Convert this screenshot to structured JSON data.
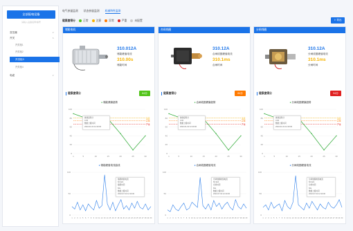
{
  "sidebar": {
    "title": "全部配电设备",
    "subtitle": "请输入设备名称/编号",
    "items": [
      {
        "label": "变压器",
        "type": "group"
      },
      {
        "label": "开关",
        "type": "group"
      },
      {
        "label": "开关柜1",
        "type": "sub"
      },
      {
        "label": "开关柜2",
        "type": "sub"
      },
      {
        "label": "开关柜3",
        "type": "sub",
        "active": true
      },
      {
        "label": "开关柜4",
        "type": "sub"
      },
      {
        "label": "电缆",
        "type": "group"
      }
    ]
  },
  "tabs": [
    {
      "label": "电气参量监测"
    },
    {
      "label": "状态参量监测"
    },
    {
      "label": "机械特性监测",
      "active": true
    }
  ],
  "legend": {
    "title": "健康度得分",
    "items": [
      {
        "label": "正常",
        "color": "#52c41a"
      },
      {
        "label": "注意",
        "color": "#f6b300"
      },
      {
        "label": "异常",
        "color": "#ff7a00"
      },
      {
        "label": "严重",
        "color": "#e02020"
      },
      {
        "label": "未配置",
        "color": "#cccccc"
      }
    ]
  },
  "export_label": "导出",
  "columns": [
    {
      "header": "储能电机",
      "value1": "310.012A",
      "label1": "储能峰值电流",
      "value2": "310.00s",
      "label2": "储能时间",
      "health_label": "健康度得分",
      "score": "84分",
      "score_color": "#52c41a",
      "trend_title": "储能健康趋势",
      "current_title": "储能峰值电流曲线",
      "tip1": [
        "健康度得分",
        "0.05",
        "数据上报时间",
        "2022-01-02 12:20:00"
      ],
      "tip2": [
        "储能峰值电流",
        "60.32A",
        "储能时间",
        "60s",
        "数据上报时间",
        "2022-07-02 12:20:00"
      ]
    },
    {
      "header": "合闸线圈",
      "value1": "310.12A",
      "label1": "合闸线圈峰值电流",
      "value2": "310.1ms",
      "label2": "合闸时间",
      "health_label": "健康度得分",
      "score": "84分",
      "score_color": "#ff7a00",
      "trend_title": "合闸线圈健康趋势",
      "current_title": "合闸线圈峰值电流",
      "tip1": [
        "健康度得分",
        "0.00",
        "数据上报时间",
        "2022-01-02 12:20:00"
      ],
      "tip2": [
        "合闸线圈峰值电流",
        "60.32A",
        "合闸时间",
        "60s",
        "数据上报时间",
        "2022-07-02 12:20:00"
      ]
    },
    {
      "header": "分闸线圈",
      "value1": "310.12A",
      "label1": "分闸线圈峰值电流",
      "value2": "310.1ms",
      "label2": "分闸时间",
      "health_label": "健康度得分",
      "score": "94分",
      "score_color": "#e02020",
      "trend_title": "分闸线圈健康趋势",
      "current_title": "分闸线圈峰值电流",
      "tip1": [
        "健康度得分",
        "0.06",
        "数据上报时间",
        "2022-01-02 12:20:00"
      ],
      "tip2": [
        "分闸线圈峰值电流",
        "60.32A",
        "分闸时间",
        "60s",
        "数据上报时间",
        "2022-07-02 12:20:00"
      ]
    }
  ],
  "chart_data": [
    {
      "type": "line",
      "x": [
        1,
        5,
        10,
        15,
        20,
        25,
        30
      ],
      "xticks": [
        "1",
        "5",
        "10",
        "15",
        "20",
        "25",
        "30"
      ],
      "yticks": [
        "0",
        "20",
        "40",
        "60",
        "80",
        "100"
      ],
      "ylim": [
        0,
        100
      ],
      "thresholds": [
        {
          "value": 80,
          "label": "注意",
          "color": "#f6b300"
        },
        {
          "value": 74,
          "label": "异常",
          "color": "#ff7a00"
        },
        {
          "value": 66,
          "label": "严重",
          "color": "#e02020"
        }
      ],
      "series": [
        {
          "values": [
            90,
            82,
            65,
            78,
            45,
            8,
            40
          ],
          "color": "#3cb043"
        }
      ]
    },
    {
      "type": "line",
      "x": [
        1,
        5,
        10,
        15,
        20,
        25,
        30
      ],
      "xticks": [
        "1",
        "5",
        "10",
        "15",
        "20",
        "25",
        "30"
      ],
      "yticks": [
        "0",
        "20",
        "40",
        "60",
        "80",
        "100"
      ],
      "ylim": [
        0,
        100
      ],
      "thresholds": [
        {
          "value": 80,
          "label": "注意",
          "color": "#f6b300"
        },
        {
          "value": 74,
          "label": "异常",
          "color": "#ff7a00"
        },
        {
          "value": 66,
          "label": "严重",
          "color": "#e02020"
        }
      ],
      "series": [
        {
          "values": [
            90,
            82,
            65,
            78,
            45,
            8,
            40
          ],
          "color": "#3cb043"
        }
      ]
    },
    {
      "type": "line",
      "x": [
        1,
        5,
        10,
        15,
        20,
        25,
        30
      ],
      "xticks": [
        "1",
        "5",
        "10",
        "15",
        "20",
        "25",
        "30"
      ],
      "yticks": [
        "0",
        "20",
        "40",
        "60",
        "80",
        "100"
      ],
      "ylim": [
        0,
        100
      ],
      "thresholds": [
        {
          "value": 80,
          "label": "注意",
          "color": "#f6b300"
        },
        {
          "value": 74,
          "label": "异常",
          "color": "#ff7a00"
        },
        {
          "value": 66,
          "label": "严重",
          "color": "#e02020"
        }
      ],
      "series": [
        {
          "values": [
            90,
            82,
            65,
            78,
            45,
            8,
            40
          ],
          "color": "#3cb043"
        }
      ]
    },
    {
      "type": "line",
      "xticks": [
        "1",
        "2",
        "3",
        "4",
        "5",
        "6",
        "7",
        "8",
        "9",
        "10",
        "11",
        "12",
        "13",
        "14",
        "15",
        "16",
        "17",
        "18",
        "19",
        "20",
        "21",
        "22",
        "23",
        "24",
        "25",
        "26",
        "27",
        "28",
        "29",
        "30"
      ],
      "yticks": [
        "0",
        "50",
        "100"
      ],
      "ylim": [
        0,
        100
      ],
      "series": [
        {
          "values": [
            20,
            14,
            30,
            12,
            24,
            10,
            26,
            18,
            12,
            34,
            16,
            22,
            94,
            26,
            12,
            30,
            10,
            24,
            36,
            14,
            22,
            12,
            28,
            16,
            32,
            18,
            14,
            26,
            12,
            20
          ],
          "color": "#2b7de9"
        }
      ]
    },
    {
      "type": "line",
      "xticks": [
        "1",
        "2",
        "3",
        "4",
        "5",
        "6",
        "7",
        "8",
        "9",
        "10",
        "11",
        "12",
        "13",
        "14",
        "15",
        "16",
        "17",
        "18",
        "19",
        "20",
        "21",
        "22",
        "23",
        "24",
        "25",
        "26",
        "27",
        "28",
        "29",
        "30"
      ],
      "yticks": [
        "0",
        "50",
        "100"
      ],
      "ylim": [
        0,
        100
      ],
      "series": [
        {
          "values": [
            12,
            8,
            24,
            14,
            10,
            20,
            28,
            12,
            16,
            30,
            24,
            18,
            88,
            22,
            14,
            26,
            12,
            34,
            20,
            28,
            14,
            24,
            30,
            18,
            12,
            36,
            20,
            14,
            26,
            16
          ],
          "color": "#2b7de9"
        }
      ]
    },
    {
      "type": "line",
      "xticks": [
        "1",
        "2",
        "3",
        "4",
        "5",
        "6",
        "7",
        "8",
        "9",
        "10",
        "11",
        "12",
        "13",
        "14",
        "15",
        "16",
        "17",
        "18",
        "19",
        "20",
        "21",
        "22",
        "23",
        "24",
        "25",
        "26",
        "27",
        "28",
        "29",
        "30"
      ],
      "yticks": [
        "0",
        "50",
        "100"
      ],
      "ylim": [
        0,
        100
      ],
      "series": [
        {
          "values": [
            18,
            24,
            12,
            30,
            16,
            22,
            26,
            10,
            34,
            20,
            14,
            30,
            92,
            24,
            18,
            12,
            28,
            16,
            32,
            22,
            12,
            26,
            18,
            14,
            30,
            20,
            16,
            24,
            36,
            18
          ],
          "color": "#2b7de9"
        }
      ]
    }
  ]
}
